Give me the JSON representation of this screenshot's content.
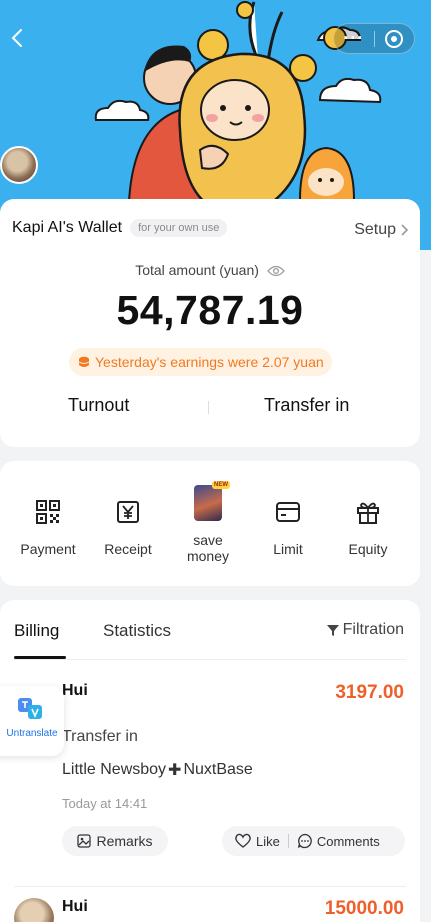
{
  "capsule": {
    "more_label": "···"
  },
  "wallet": {
    "title": "Kapi AI's Wallet",
    "tag": "for your own use",
    "setup": "Setup",
    "total_label": "Total amount (yuan)",
    "amount": "54,787.19",
    "earnings": "Yesterday's earnings were 2.07 yuan",
    "turnout": "Turnout",
    "transfer_in": "Transfer in"
  },
  "services": [
    {
      "label": "Payment",
      "icon": "qr-code-icon"
    },
    {
      "label": "Receipt",
      "icon": "yuan-receipt-icon"
    },
    {
      "label": "save\nmoney",
      "line1": "save",
      "line2": "money",
      "icon": "save-money-image"
    },
    {
      "label": "Limit",
      "icon": "card-icon"
    },
    {
      "label": "Equity",
      "icon": "gift-icon"
    }
  ],
  "save_tag": "NEW",
  "billing": {
    "tab_billing": "Billing",
    "tab_statistics": "Statistics",
    "filtration": "Filtration",
    "rows": [
      {
        "name": "Hui",
        "amount": "3197.00",
        "type": "Transfer in",
        "note_left": "Little Newsboy",
        "note_plus": "✚",
        "note_right": "NuxtBase",
        "time": "Today at 14:41",
        "remarks": "Remarks",
        "like": "Like",
        "comments": "Comments"
      },
      {
        "name": "Hui",
        "amount": "15000.00"
      }
    ]
  },
  "untranslate_label": "Untranslate",
  "colors": {
    "hero_bg": "#3ab0ee",
    "amount_orange": "#ef5f2a",
    "earnings_bg": "#fff2e2"
  }
}
